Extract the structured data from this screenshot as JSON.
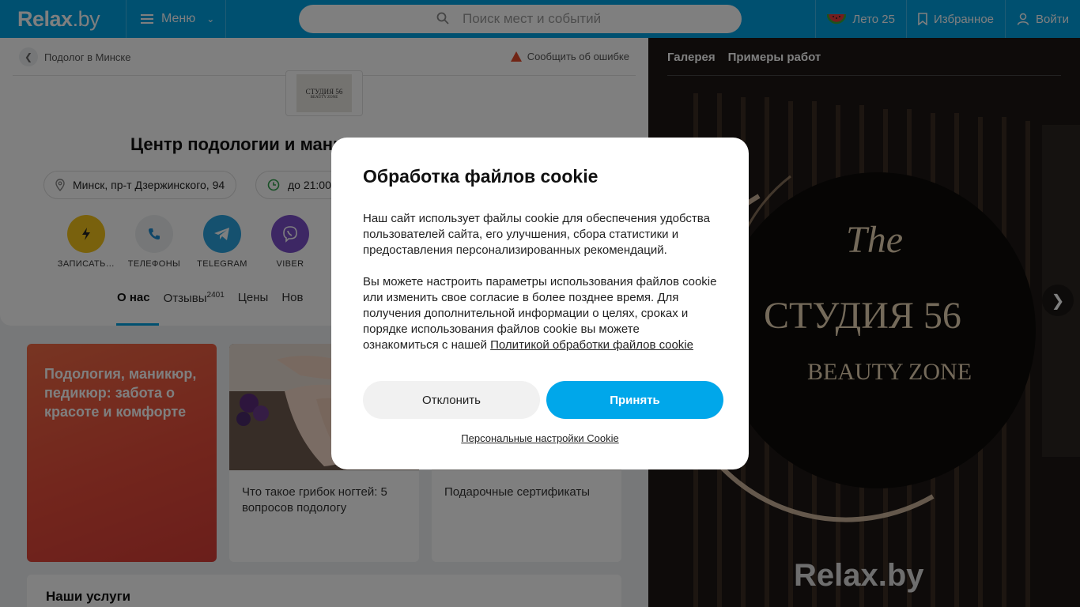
{
  "header": {
    "logo": "Relax",
    "logo_suffix": ".by",
    "menu_label": "Меню",
    "search_placeholder": "Поиск мест и событий",
    "summer_label": "Лето 25",
    "favorites_label": "Избранное",
    "login_label": "Войти"
  },
  "breadcrumb": {
    "label": "Подолог в Минске"
  },
  "report": {
    "label": "Сообщить об ошибке"
  },
  "venue": {
    "logo_line1": "СТУДИЯ 56",
    "logo_line2": "BEAUTY ZONE",
    "title": "Центр подологии и маникюра Студия 56",
    "address": "Минск, пр-т Дзержинского, 94",
    "hours": "до 21:00"
  },
  "actions": [
    {
      "label": "ЗАПИСАТЬ…",
      "color": "#f2c21b"
    },
    {
      "label": "ТЕЛЕФОНЫ",
      "color": "#eceff1"
    },
    {
      "label": "TELEGRAM",
      "color": "#2aa3df"
    },
    {
      "label": "VIBER",
      "color": "#7a4fc9"
    }
  ],
  "tabs": [
    {
      "label": "О нас",
      "count": ""
    },
    {
      "label": "Отзывы",
      "count": "2401"
    },
    {
      "label": "Цены",
      "count": ""
    },
    {
      "label": "Нов",
      "count": ""
    }
  ],
  "promo": {
    "title": "Подология, маникюр, педикюр: забота о красоте и комфорте"
  },
  "articles": [
    {
      "title": "Что такое грибок ногтей: 5 вопросов подологу"
    },
    {
      "title": "Подарочные сертификаты"
    }
  ],
  "services": {
    "title": "Наши услуги"
  },
  "gallery": {
    "tabs": [
      "Галерея",
      "Примеры работ"
    ],
    "sign_the": "The",
    "sign_main": "СТУДИЯ 56",
    "sign_sub": "BEAUTY ZONE",
    "watermark": "Relax.by"
  },
  "cookie_modal": {
    "title": "Обработка файлов cookie",
    "paragraph1": "Наш сайт использует файлы cookie для обеспечения удобства пользователей сайта, его улучшения, сбора статистики и предоставления персонализированных рекомендаций.",
    "paragraph2": "Вы можете настроить параметры использования файлов cookie или изменить свое согласие в более позднее время. Для получения дополнительной информации о целях, сроках и порядке использования файлов cookie вы можете ознакомиться с нашей",
    "policy_link": "Политикой обработки файлов cookie",
    "decline_label": "Отклонить",
    "accept_label": "Принять",
    "settings_link": "Персональные настройки Cookie"
  },
  "colors": {
    "brand": "#00a0e0",
    "accept": "#00a7ea",
    "promo": "#e64c3a"
  }
}
